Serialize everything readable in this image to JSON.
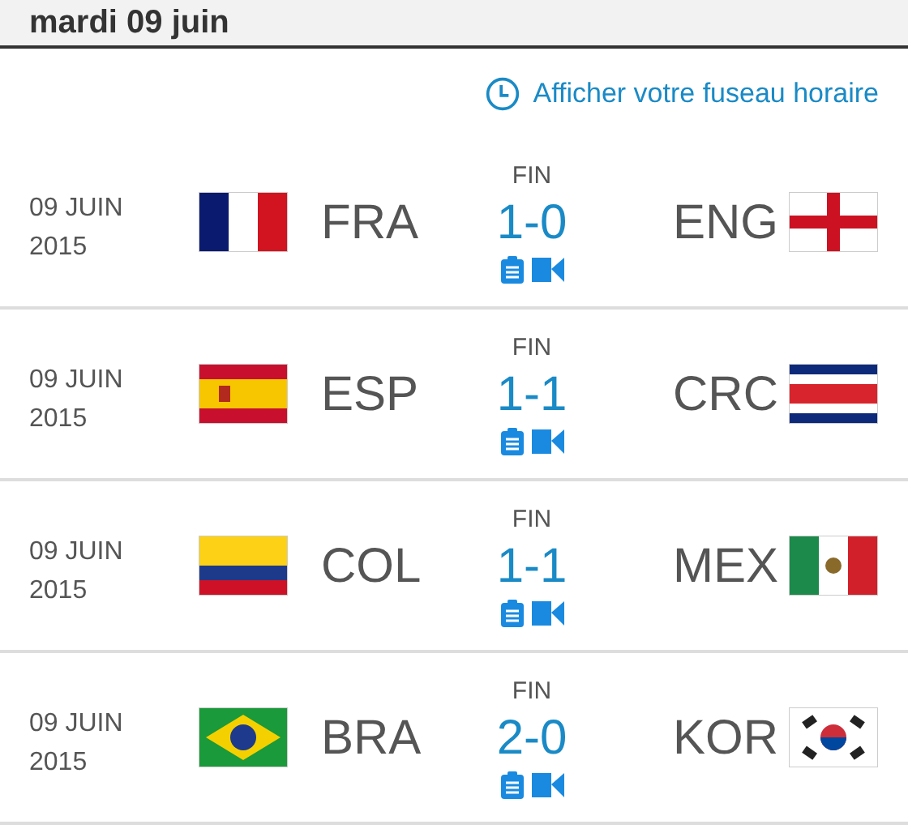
{
  "header": {
    "title": "mardi 09 juin"
  },
  "timezone_link": "Afficher votre fuseau horaire",
  "matches": [
    {
      "date": "09 JUIN",
      "year": "2015",
      "home": {
        "code": "FRA",
        "kind": "fr"
      },
      "status": "FIN",
      "score": "1-0",
      "away": {
        "code": "ENG",
        "kind": "en"
      }
    },
    {
      "date": "09 JUIN",
      "year": "2015",
      "home": {
        "code": "ESP",
        "kind": "es"
      },
      "status": "FIN",
      "score": "1-1",
      "away": {
        "code": "CRC",
        "kind": "cr"
      }
    },
    {
      "date": "09 JUIN",
      "year": "2015",
      "home": {
        "code": "COL",
        "kind": "co"
      },
      "status": "FIN",
      "score": "1-1",
      "away": {
        "code": "MEX",
        "kind": "mx"
      }
    },
    {
      "date": "09 JUIN",
      "year": "2015",
      "home": {
        "code": "BRA",
        "kind": "br"
      },
      "status": "FIN",
      "score": "2-0",
      "away": {
        "code": "KOR",
        "kind": "kr"
      }
    }
  ]
}
